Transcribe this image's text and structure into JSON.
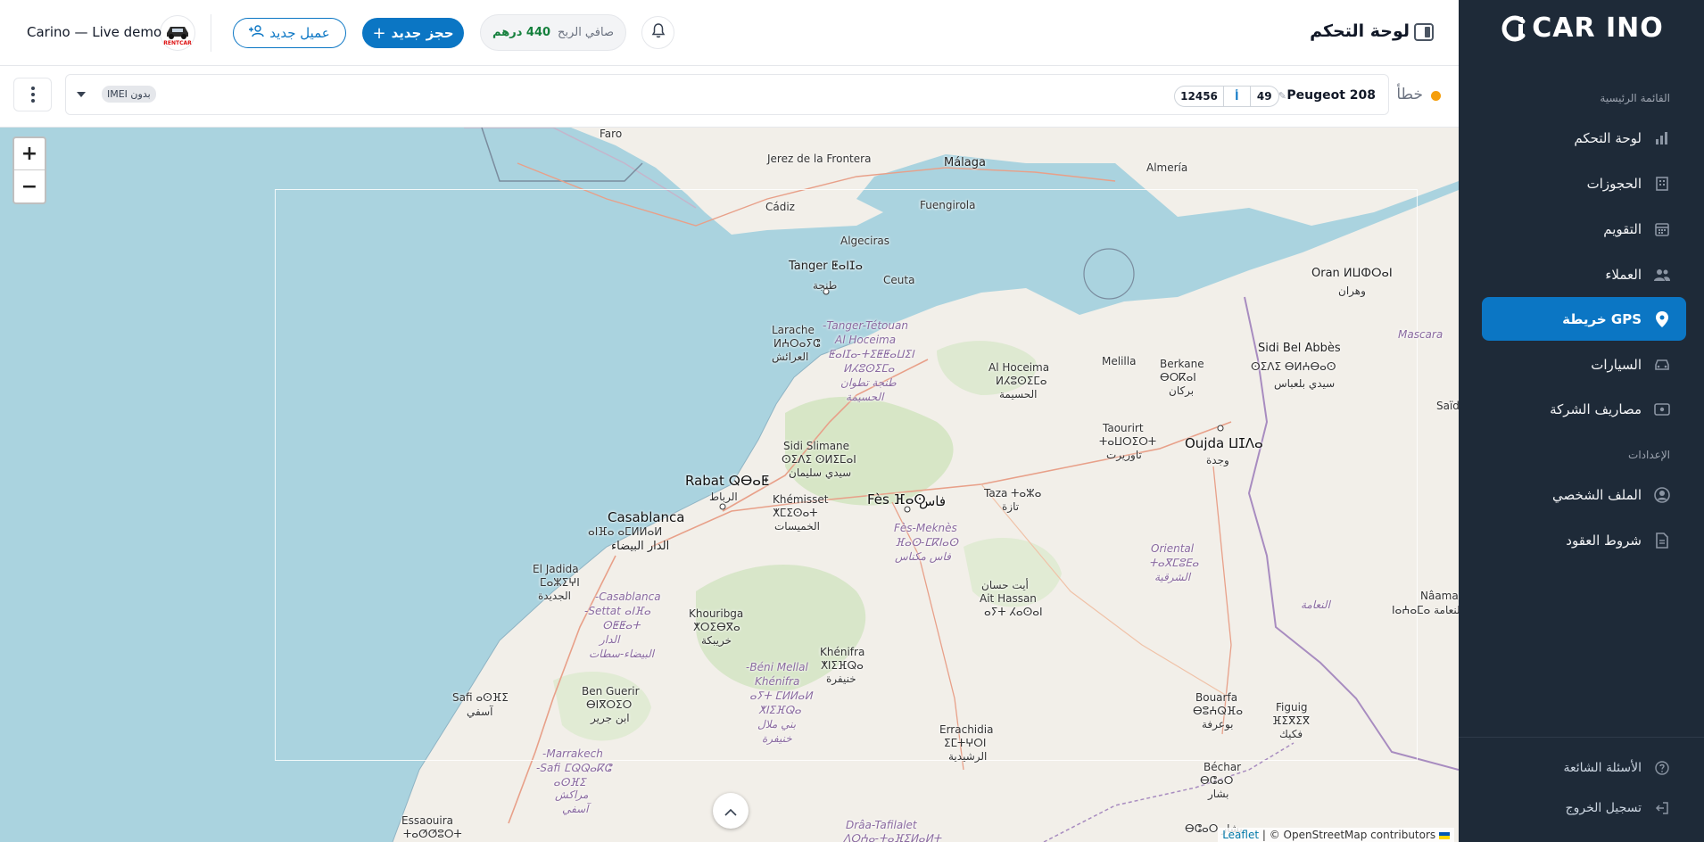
{
  "app": {
    "brand": "CAR INO",
    "page_title": "لوحة التحكم",
    "company": "Carino — Live demo",
    "logo_text": "RENTCAR"
  },
  "header": {
    "profit_label": "صافي الربح",
    "profit_value": "440 درهم",
    "new_booking": "حجز جديد",
    "new_client": "عميل جديد"
  },
  "sidebar": {
    "main_section": "القائمة الرئيسية",
    "items": [
      {
        "label": "لوحة التحكم",
        "icon": "bar-chart-icon"
      },
      {
        "label": "الحجوزات",
        "icon": "building-icon"
      },
      {
        "label": "التقويم",
        "icon": "calendar-icon"
      },
      {
        "label": "العملاء",
        "icon": "users-icon"
      },
      {
        "label": "GPS خريطة",
        "icon": "map-pin-icon"
      },
      {
        "label": "السيارات",
        "icon": "car-icon"
      },
      {
        "label": "مصاريف الشركة",
        "icon": "wallet-icon"
      }
    ],
    "settings_section": "الإعدادات",
    "settings_items": [
      {
        "label": "الملف الشخصي",
        "icon": "user-circle-icon"
      },
      {
        "label": "شروط العقود",
        "icon": "document-icon"
      }
    ],
    "footer_items": [
      {
        "label": "الأسئلة الشائعة",
        "icon": "question-icon"
      },
      {
        "label": "تسجيل الخروج",
        "icon": "logout-icon"
      }
    ]
  },
  "vehicle": {
    "status": "خطأ",
    "status_color": "#f59e0b",
    "name": "Peugeot 208",
    "plate_number": "12456",
    "plate_letter": "أ",
    "plate_region": "49",
    "imei_badge": "بدون IMEI"
  },
  "map": {
    "attribution_link": "Leaflet",
    "attribution_text": " | © OpenStreetMap contributors",
    "zoom_in": "+",
    "zoom_out": "−",
    "labels": {
      "faro": "Faro",
      "jerez": "Jerez de la Frontera",
      "cadiz": "Cádiz",
      "malaga": "Málaga",
      "almeria": "Almería",
      "fuengirola": "Fuengirola",
      "algeciras": "Algeciras",
      "tanger": "Tanger ⵟⴰⵏⵊⴰ",
      "tanger_ar": "طنجة",
      "ceuta": "Ceuta",
      "oran": "Oran ⵍⵡⵀⵔⴰⵏ",
      "oran_ar": "وهران",
      "larache": "Larache",
      "larache_tf": "ⵍⵄⵔⴰⵢⵛ",
      "larache_ar": "العرائش",
      "tth": "Tanger-Tétouan-",
      "tth2": "Al Hoceima",
      "tth3": "ⵟⴰⵏⵊⴰ-ⵜⵉⵟⵟⴰⵡⵉⵏ",
      "tth4": "ⵍⵃⵓⵙⵉⵎⴰ",
      "tth5": "طنجة تطوان",
      "tth6": "الحسيمة",
      "alhoceima": "Al Hoceima",
      "alhoceima_tf": "ⵍⵃⵓⵙⵉⵎⴰ",
      "alhoceima_ar": "الحسيمة",
      "melilla": "Melilla",
      "berkane": "Berkane",
      "berkane_tf": "ⴱⵔⴽⴰⵏ",
      "berkane_ar": "بركان",
      "sba": "Sidi Bel Abbès",
      "sba_tf": "ⵙⵉⴷⵉ ⴱⵍⵄⴱⴰⵙ",
      "sba_ar": "سيدي بلعباس",
      "mascara": "Mascara",
      "saida": "Saïd",
      "sidislimane": "Sidi Slimane",
      "sidislimane_tf": "ⵙⵉⴷⵉ ⵙⵍⵉⵎⴰⵏ",
      "sidislimane_ar": "سيدي سليمان",
      "taourirt": "Taourirt",
      "taourirt_tf": "ⵜⴰⵡⵔⵉⵔⵜ",
      "taourirt_ar": "تاوريرت",
      "oujda": "Oujda ⵡⵊⴷⴰ",
      "oujda_ar": "وجدة",
      "rabat": "Rabat ⵕⴱⴰⵟ",
      "rabat_ar": "الرباط",
      "khemisset": "Khémisset",
      "khemisset_tf": "ⵅⵎⵉⵙⴰⵜ",
      "khemisset_ar": "الخميسات",
      "fes": "Fès ⴼⴰⵙ",
      "fes_ar": "فاس",
      "taza": "Taza ⵜⴰⵣⴰ",
      "taza_ar": "تازة",
      "casa": "Casablanca",
      "casa_tf": "ⴰⵏⴼⴰ ⴰⵎⵍⵍⴰⵍ",
      "casa_ar": "الدار البيضاء",
      "fesmeknes": "Fès-Meknès",
      "fesmeknes_tf": "ⴼⴰⵙ-ⵎⴽⵏⴰⵙ",
      "fesmeknes_ar": "فاس مكناس",
      "oriental": "Oriental",
      "oriental_tf": "ⵜⴰⴳⵎⵓⴹⴰ",
      "oriental_ar": "الشرقية",
      "eljadida": "El Jadida",
      "eljadida_tf": "ⵎⴰⵣⵉⵖⵏ",
      "eljadida_ar": "الجديدة",
      "casasettat": "Casablanca-",
      "casasettat2": "Settat ⴰⵏⴼⴰ-",
      "casasettat3": "ⵙⵟⵟⴰⵜ",
      "casasettat4": "الدار",
      "casasettat5": "البيضاء-سطات",
      "khouribga": "Khouribga",
      "khouribga_tf": "ⵅⵔⵉⴱⴳⴰ",
      "khouribga_ar": "خريبكة",
      "aithassan": "أيت حسان",
      "aithassan2": "Ait Hassan",
      "aithassan_tf": "ⴰⵢⵜ ⵃⴰⵙⴰⵏ",
      "naama": "Nâama",
      "naama_ar": "النعامة",
      "naama_ar2": "النعامة ⵏⴰⵄⴰⵎⴰ",
      "khenifra": "Khénifra",
      "khenifra_tf": "ⵅⵏⵉⴼⵕⴰ",
      "khenifra_ar": "خنيفرة",
      "benimellal": "Béni Mellal-",
      "benimellal2": "Khénifra",
      "benimellal3": "ⴰⵢⵜ ⵎⵍⵍⴰⵍ",
      "benimellal4": "ⵅⵏⵉⴼⵕⴰ",
      "benimellal5": "بني ملال",
      "benimellal6": "خنيفرة",
      "safi": "Safi ⴰⵙⴼⵉ",
      "safi_ar": "آسفي",
      "benguerir": "Ben Guerir",
      "benguerir_tf": "ⴱⵏⴳⵔⵉⵔ",
      "benguerir_ar": "ابن جرير",
      "errachidia": "Errachidia",
      "errachidia_tf": "ⵉⵎⵜⵖⵔⵏ",
      "errachidia_ar": "الرشيدية",
      "bouarfa": "Bouarfa",
      "bouarfa_tf": "ⴱⵓⵄⵕⴼⴰ",
      "bouarfa_ar": "بوعرفة",
      "figuig": "Figuig",
      "figuig_tf": "ⴼⵉⴳⵉⴳ",
      "figuig_ar": "فكيك",
      "marrakech": "Marrakech-",
      "marrakech2": "Safi ⵎⵕⵕⴰⴽⵛ-",
      "marrakech3": "ⴰⵙⴼⵉ",
      "marrakech4": "مراكش",
      "marrakech5": "آسفي",
      "bechar": "Béchar",
      "bechar_tf": "ⴱⵛⴰⵔ",
      "bechar_ar": "بشار",
      "essaouira": "Essaouira",
      "essaouira_tf": "ⵜⴰⵚⵚⵓⵔⵜ",
      "draa": "Drâa-Tafilalet",
      "draa_tf": "ⴷⵔⵄⴰ-ⵜⴰⴼⵉⵍⴰⵍⵜ",
      "draa_ar": "بشار ⴱⵛⴰⵔ"
    }
  }
}
